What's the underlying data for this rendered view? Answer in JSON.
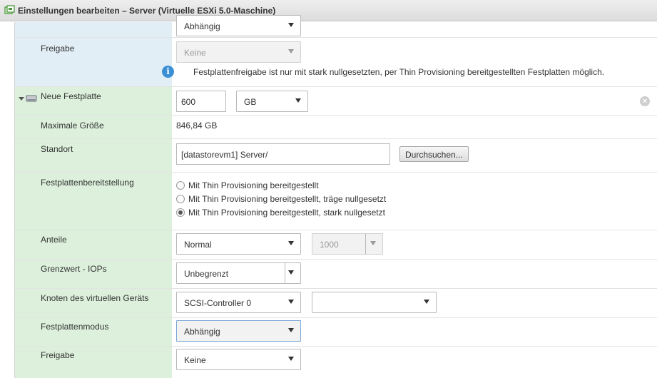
{
  "window": {
    "title": "Einstellungen bearbeiten – Server (Virtuelle ESXi 5.0-Maschine)",
    "icon": "vm-edit-icon"
  },
  "top_partial": {
    "mode_value": "Abhängig",
    "share_label": "Freigabe",
    "share_value": "Keine",
    "share_info": "Festplattenfreigabe ist nur mit stark nullgesetzten, per Thin Provisioning bereitgestellten Festplatten möglich."
  },
  "disk": {
    "title": "Neue Festplatte",
    "size_value": "600",
    "size_unit": "GB",
    "max_size_label": "Maximale Größe",
    "max_size_value": "846,84 GB",
    "location_label": "Standort",
    "location_value": "[datastorevm1] Server/",
    "browse_label": "Durchsuchen...",
    "provisioning_label": "Festplattenbereitstellung",
    "provisioning_options": [
      {
        "label": "Mit Thin Provisioning bereitgestellt",
        "selected": false
      },
      {
        "label": "Mit Thin Provisioning bereitgestellt, träge nullgesetzt",
        "selected": false
      },
      {
        "label": "Mit Thin Provisioning bereitgestellt, stark nullgesetzt",
        "selected": true
      }
    ],
    "shares_label": "Anteile",
    "shares_value": "Normal",
    "shares_number": "1000",
    "iops_label": "Grenzwert - IOPs",
    "iops_value": "Unbegrenzt",
    "node_label": "Knoten des virtuellen Geräts",
    "node_controller": "SCSI-Controller 0",
    "node_slot": "",
    "mode_label": "Festplattenmodus",
    "mode_value": "Abhängig",
    "share_label": "Freigabe",
    "share_value": "Keine"
  },
  "colors": {
    "label_blue": "#e1eef6",
    "label_green": "#dcf0dc",
    "info_icon": "#3b8fd4"
  }
}
